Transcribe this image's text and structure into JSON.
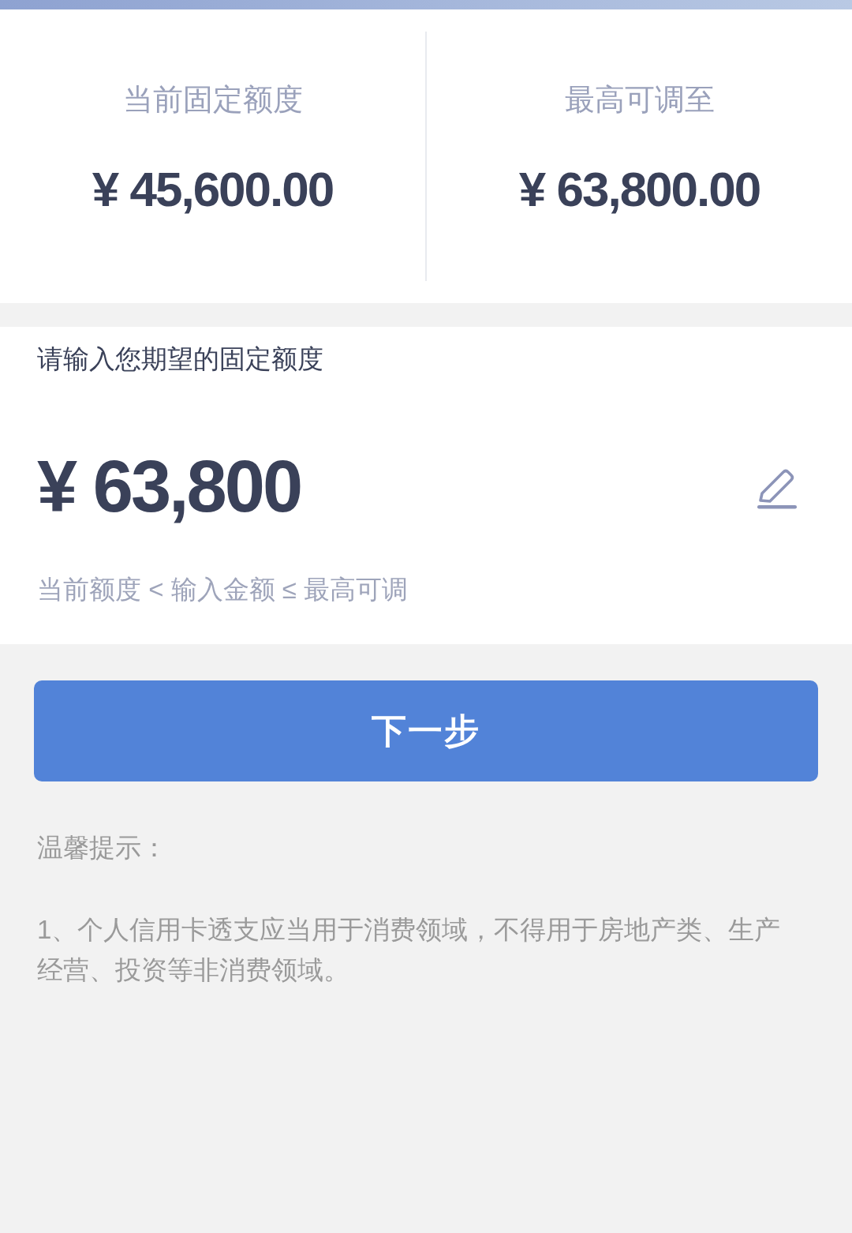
{
  "limits": [
    {
      "label": "当前固定额度",
      "value": "¥ 45,600.00"
    },
    {
      "label": "最高可调至",
      "value": "¥ 63,800.00"
    }
  ],
  "amount_input": {
    "label": "请输入您期望的固定额度",
    "value": "¥ 63,800",
    "hint": "当前额度 < 输入金额 ≤ 最高可调"
  },
  "next_button": {
    "label": "下一步"
  },
  "tips": {
    "title": "温馨提示：",
    "items": [
      "1、个人信用卡透支应当用于消费领域，不得用于房地产类、生产经营、投资等非消费领域。"
    ]
  }
}
